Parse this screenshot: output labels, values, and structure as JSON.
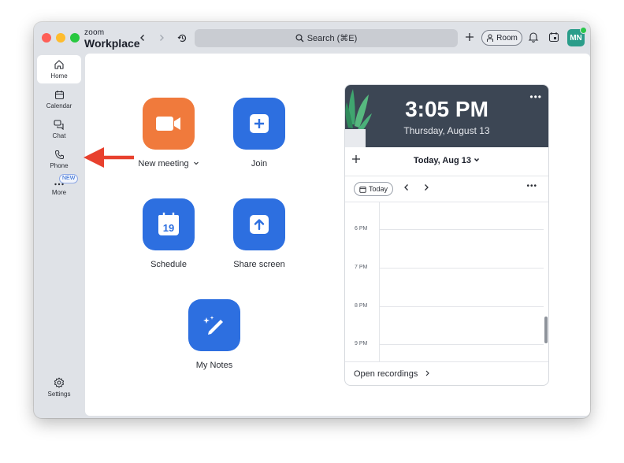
{
  "app": {
    "brand_small": "zoom",
    "brand_large": "Workplace"
  },
  "toolbar": {
    "search_label": "Search (⌘E)",
    "room_label": "Room",
    "avatar_initials": "MN"
  },
  "sidebar": {
    "items": [
      {
        "label": "Home"
      },
      {
        "label": "Calendar"
      },
      {
        "label": "Chat"
      },
      {
        "label": "Phone"
      },
      {
        "label": "More"
      }
    ],
    "new_badge": "NEW",
    "settings_label": "Settings"
  },
  "actions": {
    "new_meeting": "New meeting",
    "join": "Join",
    "schedule": "Schedule",
    "schedule_date": "19",
    "share_screen": "Share screen",
    "my_notes": "My Notes"
  },
  "calendar": {
    "time": "3:05 PM",
    "date": "Thursday, August 13",
    "today_label": "Today, Aug 13",
    "today_button": "Today",
    "hours": [
      "6 PM",
      "7 PM",
      "8 PM",
      "9 PM"
    ],
    "open_recordings": "Open recordings"
  },
  "colors": {
    "accent_blue": "#2d6fe0",
    "accent_orange": "#f07a3c",
    "annotation_red": "#e8412e"
  }
}
